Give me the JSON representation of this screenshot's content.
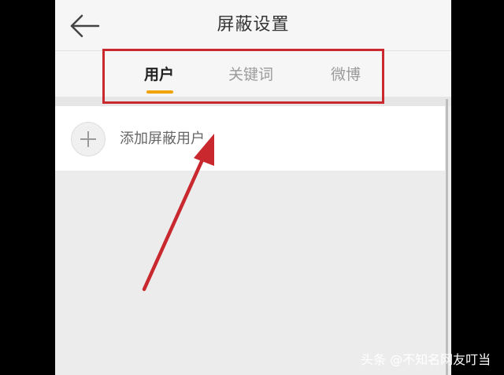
{
  "header": {
    "title": "屏蔽设置",
    "back_icon": "arrow-left-icon"
  },
  "tabs": [
    {
      "label": "用户",
      "active": true
    },
    {
      "label": "关键词",
      "active": false
    },
    {
      "label": "微博",
      "active": false
    }
  ],
  "add_row": {
    "label": "添加屏蔽用户",
    "icon": "plus-icon"
  },
  "colors": {
    "tab_accent": "#f0a300",
    "annotation_red": "#c8282e"
  },
  "watermark": "头条 @不知名网友叮当"
}
